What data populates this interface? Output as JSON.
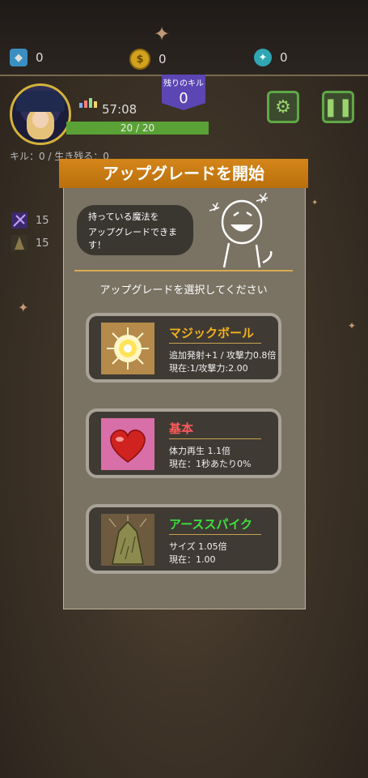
{
  "resources": {
    "gems": "0",
    "coins": "0",
    "third": "0"
  },
  "kills_banner": {
    "label": "残りのキル",
    "value": "0"
  },
  "player": {
    "timer": "57:08",
    "hp_text": "20 / 20",
    "hp_fraction": 1.0,
    "kill_stats": "キル：0 / 生き残る：0"
  },
  "weapons": [
    {
      "icon": "magic-icon",
      "count": "15"
    },
    {
      "icon": "spike-icon",
      "count": "15"
    }
  ],
  "modal": {
    "title": "アップグレードを開始",
    "bubble_line1": "持っている魔法を",
    "bubble_line2": "アップグレードできます！",
    "prompt": "アップグレードを選択してください"
  },
  "upgrades": [
    {
      "name": "マジックボール",
      "color": "#f5b21c",
      "line1": "追加発射+1 / 攻撃力0.8倍",
      "line2": "現在:1/攻撃力:2.00",
      "icon": "magic-ball-icon"
    },
    {
      "name": "基本",
      "color": "#ff5a5a",
      "line1": "体力再生 1.1倍",
      "line2": "現在：1秒あたり0%",
      "icon": "heart-icon"
    },
    {
      "name": "アーススパイク",
      "color": "#3ee03e",
      "line1": "サイズ 1.05倍",
      "line2": "現在：1.00",
      "icon": "earth-spike-icon"
    }
  ],
  "colors": {
    "accent": "#d5861a",
    "hp": "#5aa235",
    "kill_banner": "#5b46b3"
  }
}
